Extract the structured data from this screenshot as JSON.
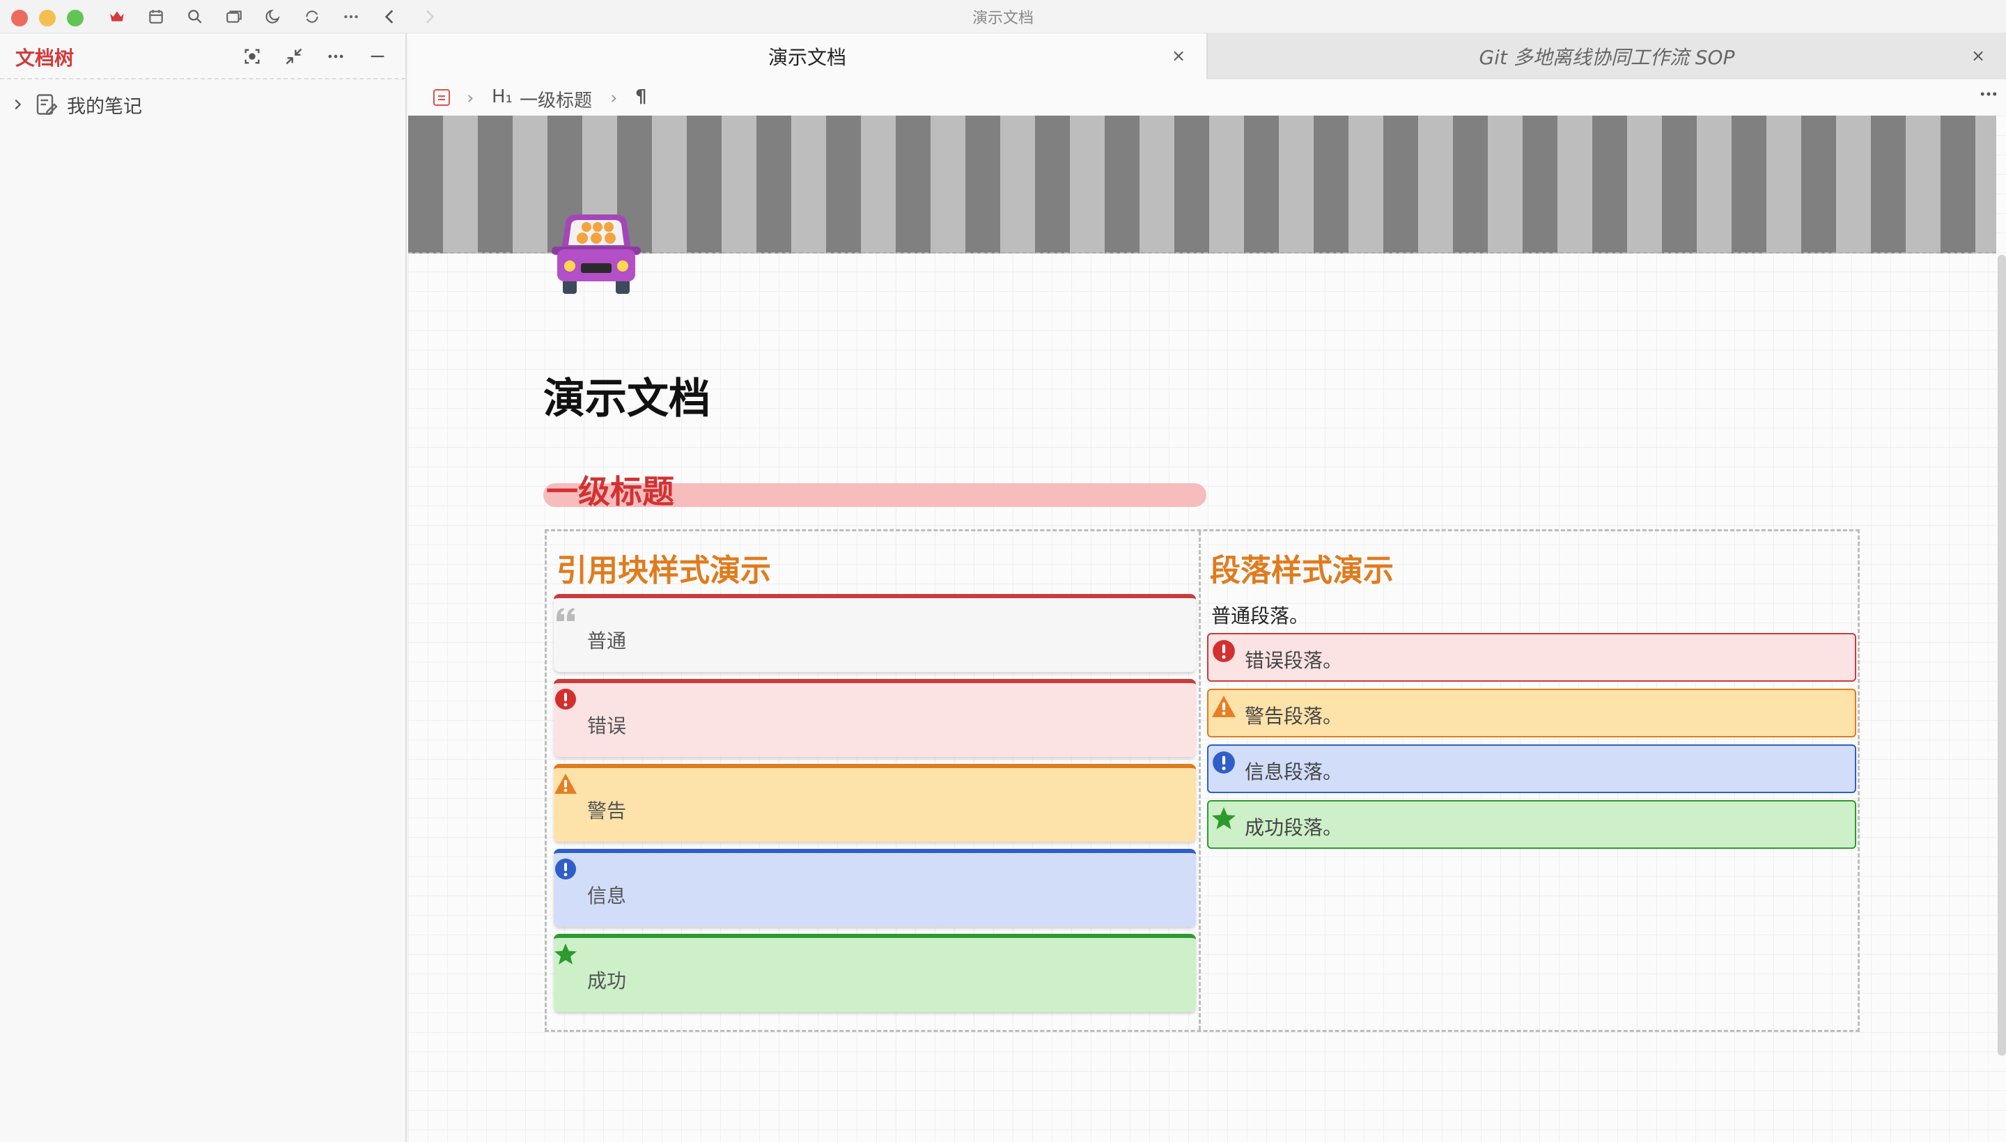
{
  "window": {
    "title": "演示文档"
  },
  "toolbar": {
    "icons": [
      "crown-icon",
      "calendar-icon",
      "search-icon",
      "window-icon",
      "moon-icon",
      "sync-icon",
      "more-icon",
      "back-icon",
      "forward-icon"
    ]
  },
  "sidebar": {
    "title": "文档树",
    "actions": [
      "focus-icon",
      "collapse-icon",
      "more-icon",
      "minimize-icon"
    ],
    "notebooks": [
      {
        "label": "我的笔记"
      }
    ]
  },
  "tabs": [
    {
      "label": "演示文档",
      "active": true
    },
    {
      "label": "Git 多地离线协同工作流 SOP",
      "active": false
    }
  ],
  "breadcrumb": {
    "heading_level": "H₁",
    "heading": "一级标题",
    "paragraph_mark": "¶"
  },
  "document": {
    "title": "演示文档",
    "h1": "一级标题",
    "left_column": {
      "heading": "引用块样式演示",
      "blocks": [
        {
          "type": "plain",
          "text": "普通"
        },
        {
          "type": "error",
          "text": "错误"
        },
        {
          "type": "warning",
          "text": "警告"
        },
        {
          "type": "info",
          "text": "信息"
        },
        {
          "type": "success",
          "text": "成功"
        }
      ]
    },
    "right_column": {
      "heading": "段落样式演示",
      "plain": "普通段落。",
      "paragraphs": [
        {
          "type": "error",
          "text": "错误段落。"
        },
        {
          "type": "warning",
          "text": "警告段落。"
        },
        {
          "type": "info",
          "text": "信息段落。"
        },
        {
          "type": "success",
          "text": "成功段落。"
        }
      ]
    }
  },
  "colors": {
    "accent_red": "#d23232",
    "accent_orange": "#e07b1d",
    "info_blue": "#2f5ec8",
    "success_green": "#2e9a2e"
  }
}
